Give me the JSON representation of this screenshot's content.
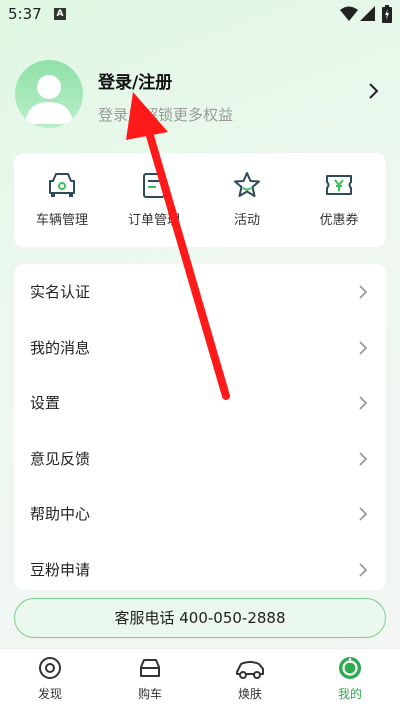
{
  "status_bar": {
    "time": "5:37",
    "notification_letter": "A"
  },
  "profile": {
    "title": "登录/注册",
    "subtitle": "登录后解锁更多权益"
  },
  "quick_actions": [
    {
      "label": "车辆管理",
      "icon": "car-manage-icon"
    },
    {
      "label": "订单管理",
      "icon": "order-icon"
    },
    {
      "label": "活动",
      "icon": "star-icon"
    },
    {
      "label": "优惠券",
      "icon": "coupon-icon"
    }
  ],
  "menu": [
    {
      "label": "实名认证"
    },
    {
      "label": "我的消息"
    },
    {
      "label": "设置"
    },
    {
      "label": "意见反馈"
    },
    {
      "label": "帮助中心"
    },
    {
      "label": "豆粉申请"
    }
  ],
  "service": {
    "label": "客服电话 400-050-2888"
  },
  "tabs": [
    {
      "label": "发现",
      "icon": "discover-icon",
      "active": false
    },
    {
      "label": "购车",
      "icon": "buy-car-icon",
      "active": false
    },
    {
      "label": "焕肤",
      "icon": "car-skin-icon",
      "active": false
    },
    {
      "label": "我的",
      "icon": "mine-icon",
      "active": true
    }
  ],
  "colors": {
    "accent": "#2faa50",
    "annotation_arrow": "#ff1a1a"
  }
}
